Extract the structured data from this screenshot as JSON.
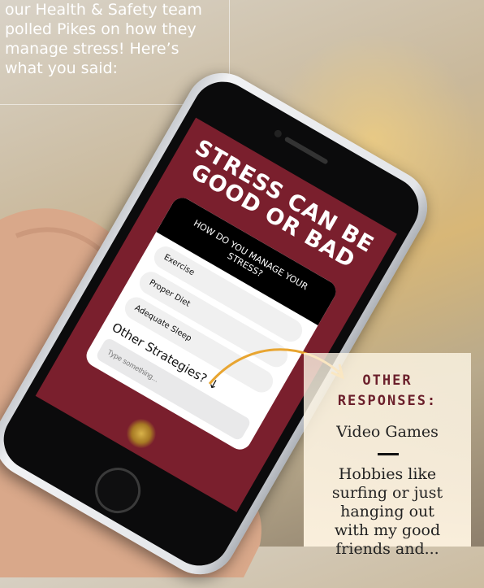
{
  "intro": {
    "text": "our Health & Safety team\npolled Pikes on how they\nmanage stress! Here’s\nwhat you said:"
  },
  "phone": {
    "screen_title": "STRESS CAN BE\nGOOD OR BAD",
    "question": "HOW DO YOU MANAGE YOUR STRESS?",
    "options": [
      "Exercise",
      "Proper Diet",
      "Adequate Sleep"
    ],
    "other_label": "Other Strategies? ↓",
    "input_placeholder": "Type something..."
  },
  "responses": {
    "title": "OTHER\nRESPONSES:",
    "items": [
      "Video Games",
      "Hobbies like\nsurfing or just\nhanging out\nwith my good\nfriends and..."
    ]
  },
  "colors": {
    "screen_maroon": "#7a1f2d",
    "accent_orange": "#e8a531",
    "title_maroon": "#6b1f2b"
  }
}
